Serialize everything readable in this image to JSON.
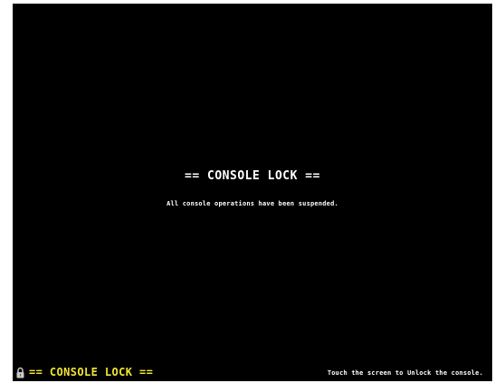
{
  "main": {
    "title": "== CONSOLE LOCK ==",
    "message": "All console operations have been suspended."
  },
  "status_bar": {
    "icon": "lock-icon",
    "title": "== CONSOLE LOCK ==",
    "hint": "Touch the screen to Unlock the console."
  },
  "colors": {
    "background": "#000000",
    "text": "#ffffff",
    "status_title": "#f0e531"
  }
}
